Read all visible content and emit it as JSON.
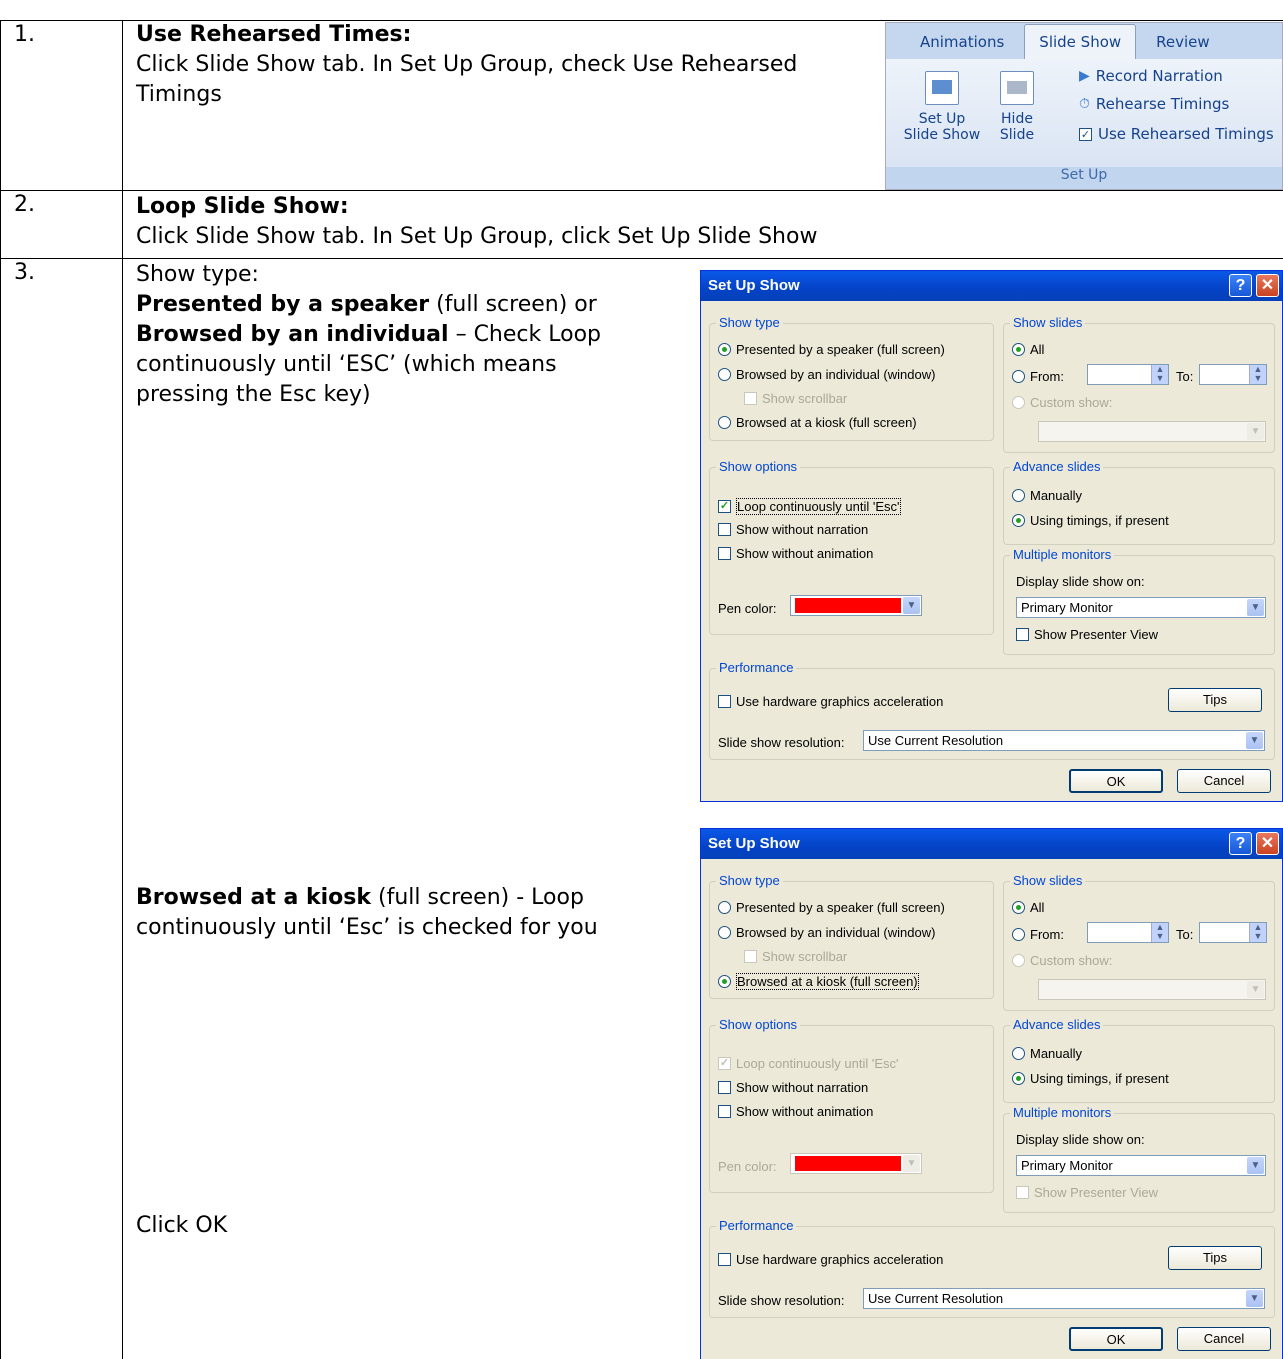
{
  "rows": [
    {
      "num": "1.",
      "title": "Use Rehearsed Times:",
      "line1": "Click Slide Show tab. In Set Up Group, check Use Rehearsed",
      "line2": "Timings"
    },
    {
      "num": "2.",
      "title": "Loop Slide Show:",
      "line1": "Click Slide Show tab. In Set Up Group, click Set Up Slide Show"
    },
    {
      "num": "3.",
      "show_type": "Show type:",
      "speaker_bold": "Presented by a speaker",
      "speaker_rest": " (full screen) or",
      "indiv_bold": "Browsed by an individual",
      "indiv_rest": " – Check Loop",
      "indiv_l2": "continuously until ‘ESC’ (which means",
      "indiv_l3": "pressing the Esc key)",
      "kiosk_bold": "Browsed at a kiosk",
      "kiosk_rest": " (full screen) -  Loop",
      "kiosk_l2": "continuously until ‘Esc’ is checked for you",
      "click_ok": "Click OK"
    }
  ],
  "ribbon": {
    "tabs": [
      "Animations",
      "Slide Show",
      "Review"
    ],
    "setup_btn": [
      "Set Up",
      "Slide Show"
    ],
    "hide_btn": [
      "Hide",
      "Slide"
    ],
    "record": "Record Narration",
    "rehearse": "Rehearse Timings",
    "use_rehearsed": "Use Rehearsed Timings",
    "group": "Set Up"
  },
  "dialog": {
    "title": "Set Up Show",
    "help": "?",
    "close": "✕",
    "show_type": "Show type",
    "opt_speaker": "Presented by a speaker (full screen)",
    "opt_individual": "Browsed by an individual (window)",
    "opt_scrollbar": "Show scrollbar",
    "opt_kiosk": "Browsed at a kiosk (full screen)",
    "show_slides": "Show slides",
    "all": "All",
    "from": "From:",
    "to": "To:",
    "custom": "Custom show:",
    "show_options": "Show options",
    "loop": "Loop continuously until 'Esc'",
    "no_narration": "Show without narration",
    "no_animation": "Show without animation",
    "pen_color": "Pen color:",
    "advance": "Advance slides",
    "manually": "Manually",
    "timings": "Using timings, if present",
    "monitors": "Multiple monitors",
    "display_on": "Display slide show on:",
    "primary": "Primary Monitor",
    "presenter": "Show Presenter View",
    "performance": "Performance",
    "hw_accel": "Use hardware graphics acceleration",
    "tips": "Tips",
    "resolution_label": "Slide show resolution:",
    "resolution": "Use Current Resolution",
    "ok": "OK",
    "cancel": "Cancel",
    "pen_hex": "#ff0000"
  }
}
